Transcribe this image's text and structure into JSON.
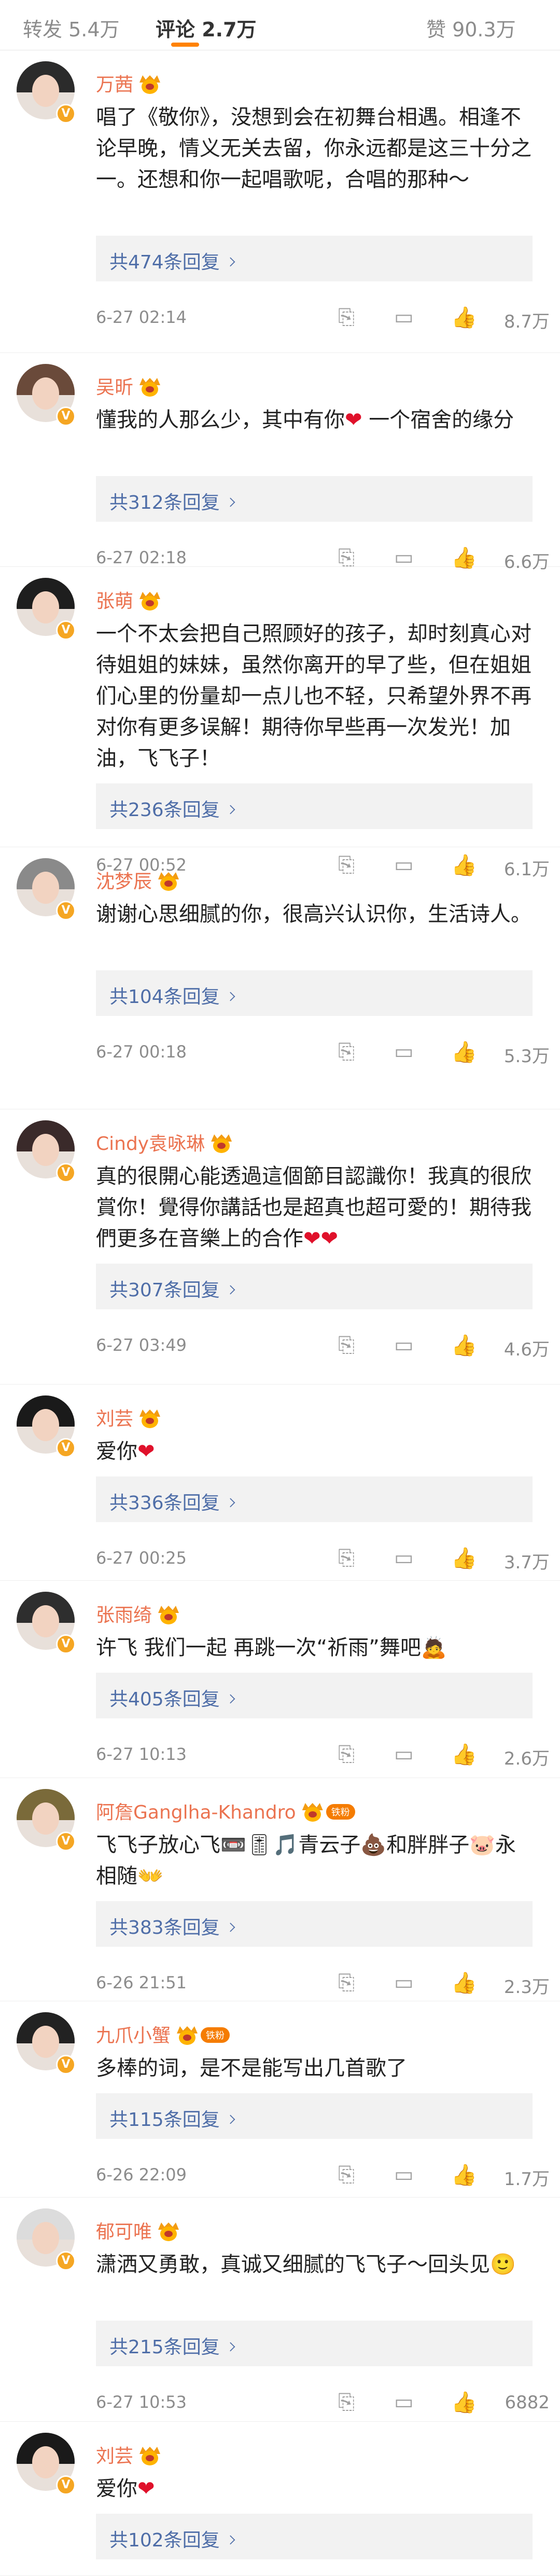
{
  "tabs": [
    {
      "label": "转发 5.4万"
    },
    {
      "label": "评论 2.7万"
    },
    {
      "label": "赞 90.3万"
    }
  ],
  "accent_color": "#ff8200",
  "username_color": "#eb7350",
  "link_color": "#4f6ea8",
  "action_icons": [
    "repost-icon",
    "comment-icon",
    "like-icon"
  ],
  "comments": [
    {
      "user": "万茜",
      "text": "唱了《敬你》，没想到会在初舞台相遇。相逢不论早晚，情义无关去留，你永远都是这三十分之一。还想和你一起唱歌呢，合唱的那种～",
      "heart": "",
      "replies": "共474条回复",
      "time": "6-27 02:14",
      "likes": "8.7万"
    },
    {
      "user": "吴昕",
      "text": "懂我的人那么少，其中有你",
      "heart": "❤",
      "text2": " 一个宿舍的缘分",
      "replies": "共312条回复",
      "time": "6-27 02:18",
      "likes": "6.6万"
    },
    {
      "user": "张萌",
      "text": "一个不太会把自己照顾好的孩子，却时刻真心对待姐姐的妹妹，虽然你离开的早了些，但在姐姐们心里的份量却一点儿也不轻，只希望外界不再对你有更多误解！期待你早些再一次发光！加油，飞飞子！",
      "heart": "",
      "replies": "共236条回复",
      "time": "6-27 00:52",
      "likes": "6.1万"
    },
    {
      "user": "沈梦辰",
      "text": "谢谢心思细腻的你，很高兴认识你，生活诗人。",
      "heart": "",
      "replies": "共104条回复",
      "time": "6-27 00:18",
      "likes": "5.3万"
    },
    {
      "user": "Cindy袁咏琳",
      "text": "真的很開心能透過這個節目認識你！我真的很欣賞你！覺得你講話也是超真也超可愛的！期待我們更多在音樂上的合作",
      "heart": "❤❤",
      "replies": "共307条回复",
      "time": "6-27 03:49",
      "likes": "4.6万"
    },
    {
      "user": "刘芸",
      "text": "爱你",
      "heart": "❤",
      "replies": "共336条回复",
      "time": "6-27 00:25",
      "likes": "3.7万"
    },
    {
      "user": "张雨绮",
      "text": "许飞 我们一起 再跳一次“祈雨”舞吧",
      "heart": "🙇",
      "replies": "共405条回复",
      "time": "6-27 10:13",
      "likes": "2.6万"
    },
    {
      "user": "阿詹Ganglha-Khandro",
      "badge": "铁粉",
      "text": "飞飞子放心飞📼🎚🎵青云子💩和胖胖子🐷永相随",
      "heart": "👐",
      "replies": "共383条回复",
      "time": "6-26 21:51",
      "likes": "2.3万"
    },
    {
      "user": "九爪小蟹",
      "badge": "铁粉",
      "text": "多棒的词，是不是能写出几首歌了",
      "heart": "",
      "replies": "共115条回复",
      "time": "6-26 22:09",
      "likes": "1.7万"
    },
    {
      "user": "郁可唯",
      "text": "潇洒又勇敢，真诚又细腻的飞飞子～回头见",
      "heart": "🙂",
      "replies": "共215条回复",
      "time": "6-27 10:53",
      "likes": "6882"
    },
    {
      "user": "刘芸",
      "text": "爱你",
      "heart": "❤",
      "replies": "共102条回复",
      "time": "",
      "likes": ""
    }
  ]
}
